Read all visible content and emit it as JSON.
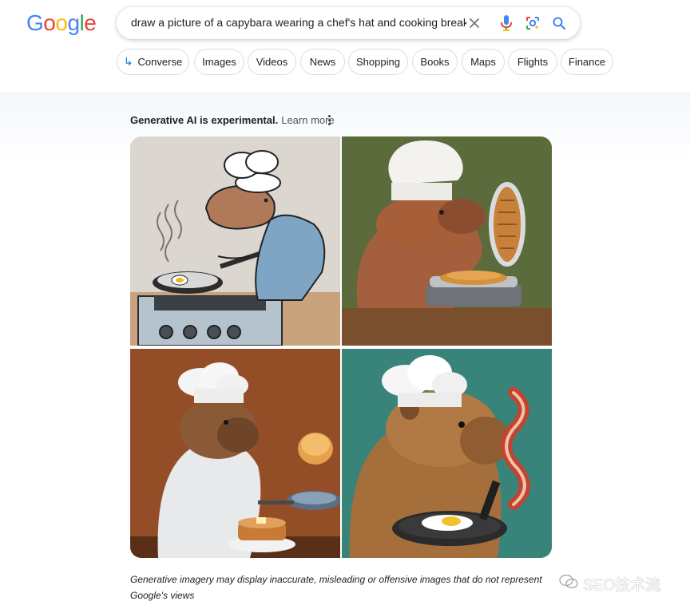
{
  "logo": {
    "letters": [
      "G",
      "o",
      "o",
      "g",
      "l",
      "e"
    ],
    "colors": [
      "#4285F4",
      "#EA4335",
      "#FBBC05",
      "#4285F4",
      "#34A853",
      "#EA4335"
    ]
  },
  "search": {
    "query": "draw a picture of a capybara wearing a chef's hat and cooking breakf"
  },
  "icons": {
    "clear": "close-icon",
    "mic": "microphone-icon",
    "lens": "lens-icon",
    "search": "search-icon"
  },
  "chips": [
    {
      "label": "Converse",
      "icon": "return-arrow-icon"
    },
    {
      "label": "Images"
    },
    {
      "label": "Videos"
    },
    {
      "label": "News"
    },
    {
      "label": "Shopping"
    },
    {
      "label": "Books"
    },
    {
      "label": "Maps"
    },
    {
      "label": "Flights"
    },
    {
      "label": "Finance"
    }
  ],
  "ai": {
    "header": "Generative AI is experimental.",
    "learn_more": "Learn more"
  },
  "images": [
    {
      "subject": "capybara-cartoon-frying-eggs"
    },
    {
      "subject": "capybara-waffle-maker"
    },
    {
      "subject": "capybara-chef-flipping-pancake"
    },
    {
      "subject": "capybara-chef-egg-and-bacon"
    }
  ],
  "disclaimer": "Generative imagery may display inaccurate, misleading or offensive images that do not represent Google's views",
  "watermark": {
    "text": "SEO技术流",
    "icon": "wechat-icon"
  },
  "colors": {
    "accent": "#1a73e8",
    "chip_border": "#dadce0",
    "text": "#202124"
  }
}
